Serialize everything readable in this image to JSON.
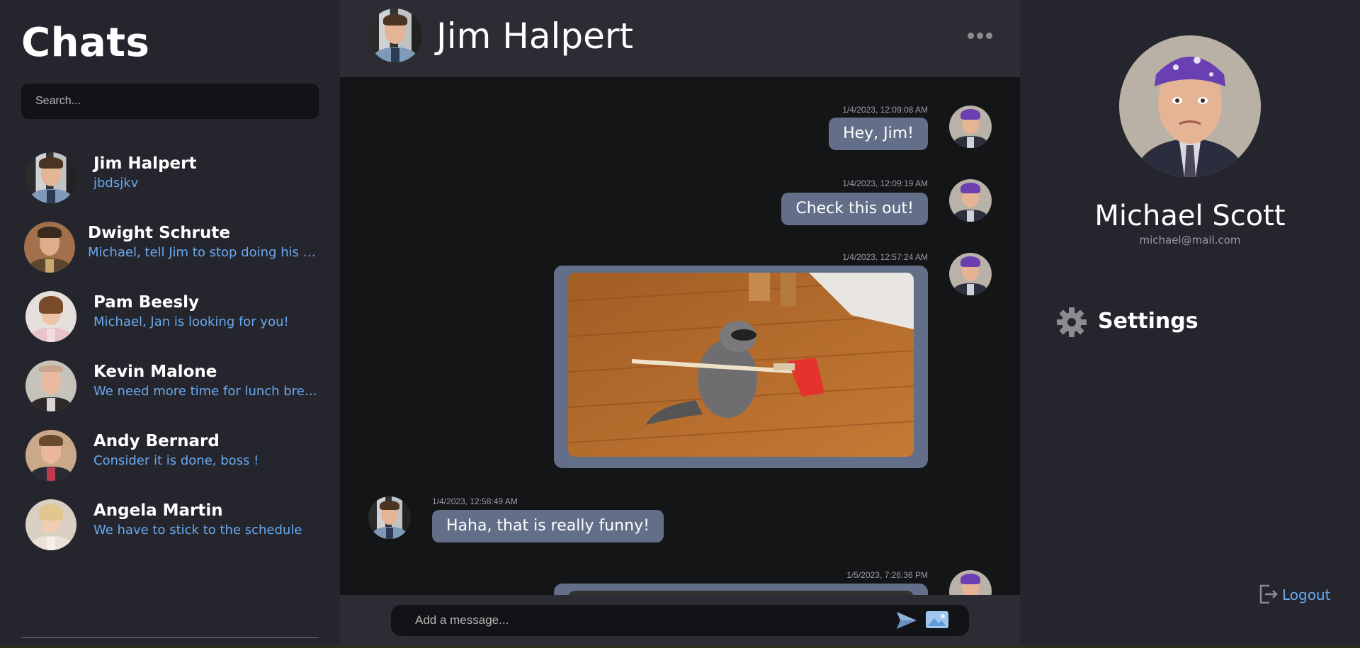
{
  "sidebar": {
    "title": "Chats",
    "search_placeholder": "Search...",
    "contacts": [
      {
        "name": "Jim Halpert",
        "preview": "jbdsjkv"
      },
      {
        "name": "Dwight Schrute",
        "preview": "Michael, tell Jim to stop doing his weird pranks on me!"
      },
      {
        "name": "Pam Beesly",
        "preview": "Michael, Jan is looking for you!"
      },
      {
        "name": "Kevin Malone",
        "preview": "We need more time for lunch breaks!"
      },
      {
        "name": "Andy Bernard",
        "preview": "Consider it is done, boss !"
      },
      {
        "name": "Angela Martin",
        "preview": "We have to stick to the schedule"
      }
    ]
  },
  "chat": {
    "header_name": "Jim Halpert",
    "messages": [
      {
        "timestamp": "1/4/2023, 12:09:08 AM",
        "text": "Hey, Jim!"
      },
      {
        "timestamp": "1/4/2023, 12:09:19 AM",
        "text": "Check this out!"
      },
      {
        "timestamp": "1/4/2023, 12:57:24 AM"
      },
      {
        "timestamp": "1/4/2023, 12:58:49 AM",
        "text": "Haha, that is really funny!"
      },
      {
        "timestamp": "1/5/2023, 7:26:36 PM"
      }
    ],
    "input_placeholder": "Add a message..."
  },
  "profile": {
    "name": "Michael Scott",
    "email": "michael@mail.com",
    "settings_label": "Settings",
    "logout_label": "Logout"
  },
  "colors": {
    "accent_blue": "#6aa8ee",
    "bubble": "#636f88",
    "panel": "#25262d",
    "header": "#2c2d34",
    "chat_bg": "#141517"
  }
}
